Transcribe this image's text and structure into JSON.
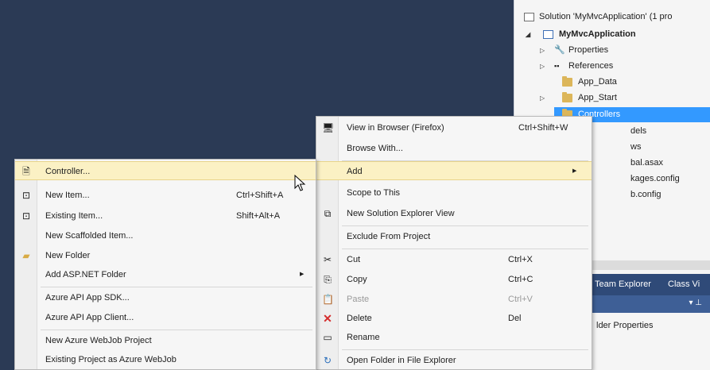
{
  "solution_explorer": {
    "solution_label": "Solution 'MyMvcApplication' (1 pro",
    "project": "MyMvcApplication",
    "properties": "Properties",
    "references": "References",
    "app_data": "App_Data",
    "app_start": "App_Start",
    "controllers": "Controllers",
    "models": "dels",
    "views": "ws",
    "global": "bal.asax",
    "packages": "kages.config",
    "webconfig": "b.config"
  },
  "bottom_panel": {
    "team_explorer": "Team Explorer",
    "class_view": "Class Vi",
    "pin_icon": "▾ ⊥",
    "props_header": "",
    "props_label": "lder Properties"
  },
  "context_menu": {
    "view_browser": "View in Browser (Firefox)",
    "view_browser_sc": "Ctrl+Shift+W",
    "browse_with": "Browse With...",
    "add": "Add",
    "scope": "Scope to This",
    "new_view": "New Solution Explorer View",
    "exclude": "Exclude From Project",
    "cut": "Cut",
    "cut_sc": "Ctrl+X",
    "copy": "Copy",
    "copy_sc": "Ctrl+C",
    "paste": "Paste",
    "paste_sc": "Ctrl+V",
    "delete": "Delete",
    "delete_sc": "Del",
    "rename": "Rename",
    "open_folder": "Open Folder in File Explorer"
  },
  "add_submenu": {
    "controller": "Controller...",
    "new_item": "New Item...",
    "new_item_sc": "Ctrl+Shift+A",
    "existing_item": "Existing Item...",
    "existing_item_sc": "Shift+Alt+A",
    "scaffolded": "New Scaffolded Item...",
    "new_folder": "New Folder",
    "asp_folder": "Add ASP.NET Folder",
    "api_sdk": "Azure API App SDK...",
    "api_client": "Azure API App Client...",
    "webjob": "New Azure WebJob Project",
    "existing_webjob": "Existing Project as Azure WebJob"
  },
  "colors": {
    "background": "#2b3a55",
    "selection": "#3399ff",
    "highlight": "#fbf1c4"
  }
}
